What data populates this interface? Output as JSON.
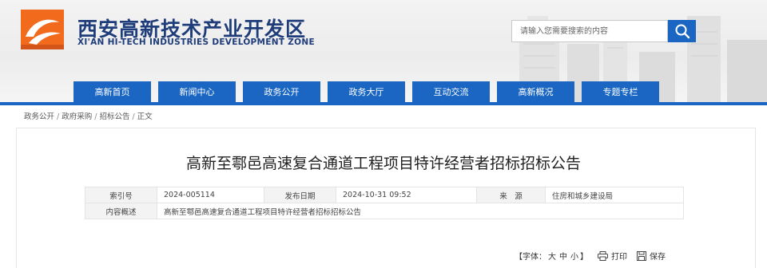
{
  "site": {
    "name_cn": "西安高新技术产业开发区",
    "name_en": "XI'AN HI-TECH INDUSTRIES DEVELOPMENT ZONE"
  },
  "search": {
    "placeholder": "请输入您需要搜索的内容",
    "icon": "search-icon"
  },
  "nav": [
    "高新首页",
    "新闻中心",
    "政务公开",
    "政务大厅",
    "互动交流",
    "高新概况",
    "专题专栏"
  ],
  "breadcrumb": [
    "政务公开",
    "政府采购",
    "招标公告",
    "正文"
  ],
  "article": {
    "title": "高新至鄠邑高速复合通道工程项目特许经营者招标招标公告",
    "meta": {
      "index_label": "索引号",
      "index_value": "2024-005114",
      "date_label": "发布日期",
      "date_value": "2024-10-31 09:52",
      "source_label": "来　源",
      "source_value": "住房和城乡建设局",
      "summary_label": "内容概述",
      "summary_value": "高新至鄠邑高速复合通道工程项目特许经营者招标招标公告"
    }
  },
  "tools": {
    "font_prefix": "【字体：",
    "size_large": "大",
    "size_medium": "中",
    "size_small": "小",
    "font_suffix": "】",
    "print": "打印",
    "save": "保存"
  },
  "colors": {
    "brand_blue": "#1a66c2",
    "logo_orange": "#f26b1d",
    "text_dark_blue": "#1f3d7a"
  }
}
